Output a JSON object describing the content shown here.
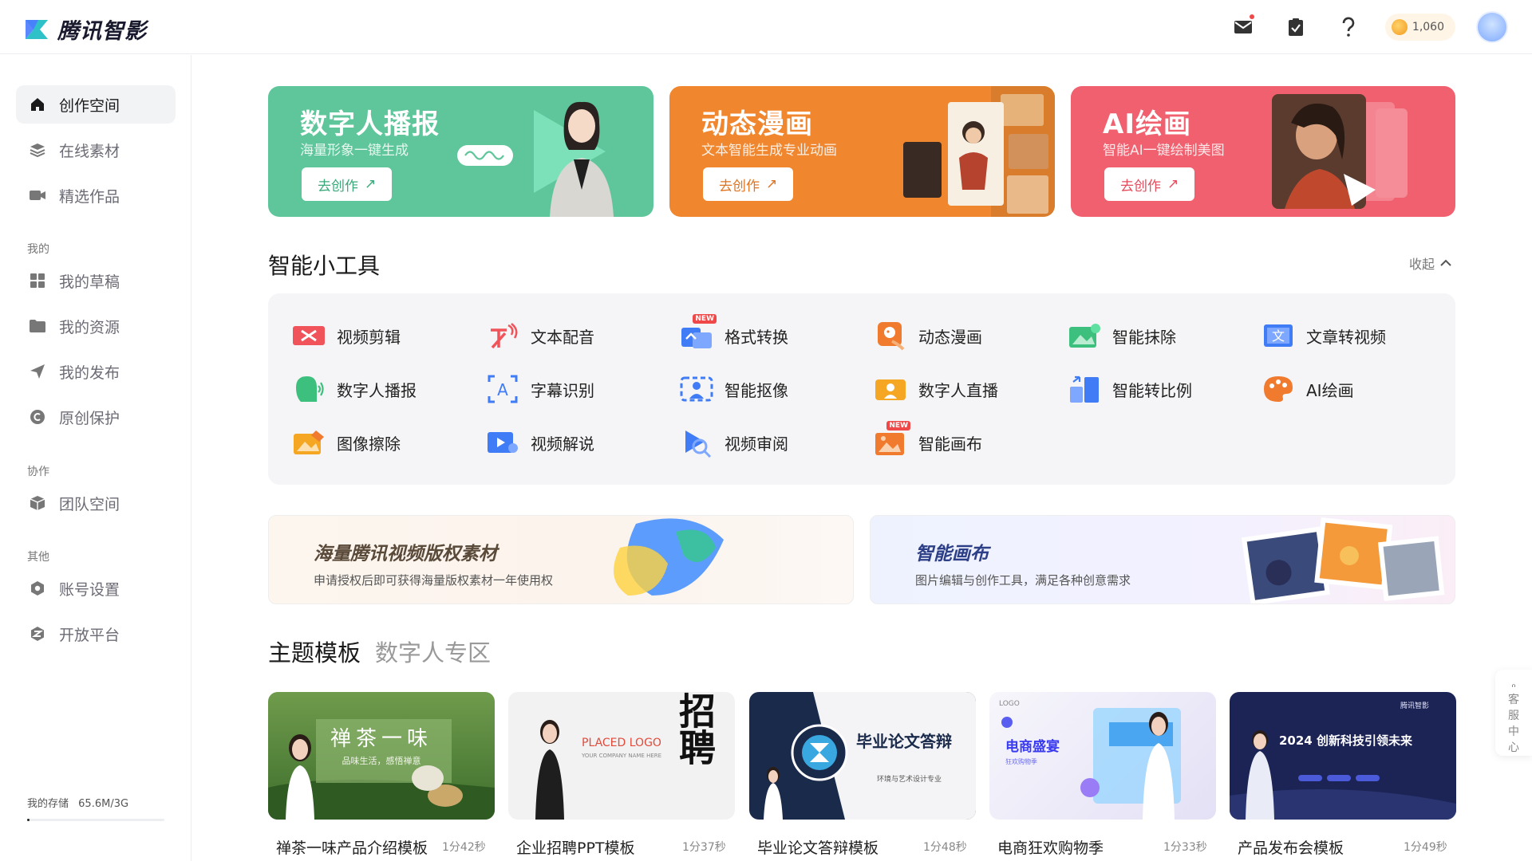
{
  "app": {
    "name": "腾讯智影"
  },
  "topbar": {
    "coins": "1,060"
  },
  "sidebar": {
    "items": [
      {
        "label": "创作空间",
        "icon": "home-icon"
      },
      {
        "label": "在线素材",
        "icon": "layers-icon"
      },
      {
        "label": "精选作品",
        "icon": "video-camera-icon"
      }
    ],
    "group_mine": "我的",
    "mine": [
      {
        "label": "我的草稿",
        "icon": "grid-icon"
      },
      {
        "label": "我的资源",
        "icon": "folder-icon"
      },
      {
        "label": "我的发布",
        "icon": "send-icon"
      },
      {
        "label": "原创保护",
        "icon": "copyright-icon"
      }
    ],
    "group_collab": "协作",
    "collab": [
      {
        "label": "团队空间",
        "icon": "cube-icon"
      }
    ],
    "group_other": "其他",
    "other": [
      {
        "label": "账号设置",
        "icon": "settings-icon"
      },
      {
        "label": "开放平台",
        "icon": "platform-icon"
      }
    ],
    "storage_label": "我的存储",
    "storage_value": "65.6M/3G",
    "storage_fraction": 0.02
  },
  "banners": [
    {
      "title": "数字人播报",
      "subtitle": "海量形象一键生成",
      "button": "去创作",
      "color": "#5ec69a"
    },
    {
      "title": "动态漫画",
      "subtitle": "文本智能生成专业动画",
      "button": "去创作",
      "color": "#f0872e"
    },
    {
      "title": "AI绘画",
      "subtitle": "智能AI一键绘制美图",
      "button": "去创作",
      "color": "#f0606e"
    }
  ],
  "tools_section": {
    "title": "智能小工具",
    "collapse": "收起"
  },
  "tools": [
    {
      "label": "视频剪辑",
      "icon": "video-edit-icon",
      "new": false
    },
    {
      "label": "文本配音",
      "icon": "text-dubbing-icon",
      "new": false
    },
    {
      "label": "格式转换",
      "icon": "format-convert-icon",
      "new": true,
      "badge": "NEW"
    },
    {
      "label": "动态漫画",
      "icon": "comic-icon",
      "new": false
    },
    {
      "label": "智能抹除",
      "icon": "erase-icon",
      "new": false
    },
    {
      "label": "文章转视频",
      "icon": "article-video-icon",
      "new": false
    },
    {
      "label": "数字人播报",
      "icon": "digital-human-icon",
      "new": false
    },
    {
      "label": "字幕识别",
      "icon": "subtitle-icon",
      "new": false
    },
    {
      "label": "智能抠像",
      "icon": "cutout-icon",
      "new": false
    },
    {
      "label": "数字人直播",
      "icon": "live-icon",
      "new": false
    },
    {
      "label": "智能转比例",
      "icon": "ratio-icon",
      "new": false
    },
    {
      "label": "AI绘画",
      "icon": "palette-icon",
      "new": false
    },
    {
      "label": "图像擦除",
      "icon": "image-erase-icon",
      "new": false
    },
    {
      "label": "视频解说",
      "icon": "video-narrate-icon",
      "new": false
    },
    {
      "label": "视频审阅",
      "icon": "video-review-icon",
      "new": false
    },
    {
      "label": "智能画布",
      "icon": "canvas-icon",
      "new": true,
      "badge": "NEW"
    }
  ],
  "promos": [
    {
      "title": "海量腾讯视频版权素材",
      "subtitle": "申请授权后即可获得海量版权素材一年使用权"
    },
    {
      "title": "智能画布",
      "subtitle": "图片编辑与创作工具，满足各种创意需求"
    }
  ],
  "template_tabs": [
    "主题模板",
    "数字人专区"
  ],
  "templates": [
    {
      "name": "禅茶一味产品介绍模板",
      "duration": "1分42秒",
      "cover_title": "禅茶一味",
      "cover_sub": "品味生活，感悟禅意"
    },
    {
      "name": "企业招聘PPT模板",
      "duration": "1分37秒",
      "cover_title": "招聘",
      "cover_sub": "PLACED LOGO",
      "cover_note": "YOUR COMPANY NAME HERE"
    },
    {
      "name": "毕业论文答辩模板",
      "duration": "1分48秒",
      "cover_title": "毕业论文答辩",
      "cover_sub": "环境与艺术设计专业"
    },
    {
      "name": "电商狂欢购物季",
      "duration": "1分33秒",
      "cover_title": "电商盛宴",
      "cover_sub": "狂欢购物季",
      "cover_note": "LOGO"
    },
    {
      "name": "产品发布会模板",
      "duration": "1分49秒",
      "cover_title": "2024 创新科技引领未来",
      "cover_sub": "腾讯智影"
    }
  ],
  "service": {
    "label": "客服中心"
  }
}
